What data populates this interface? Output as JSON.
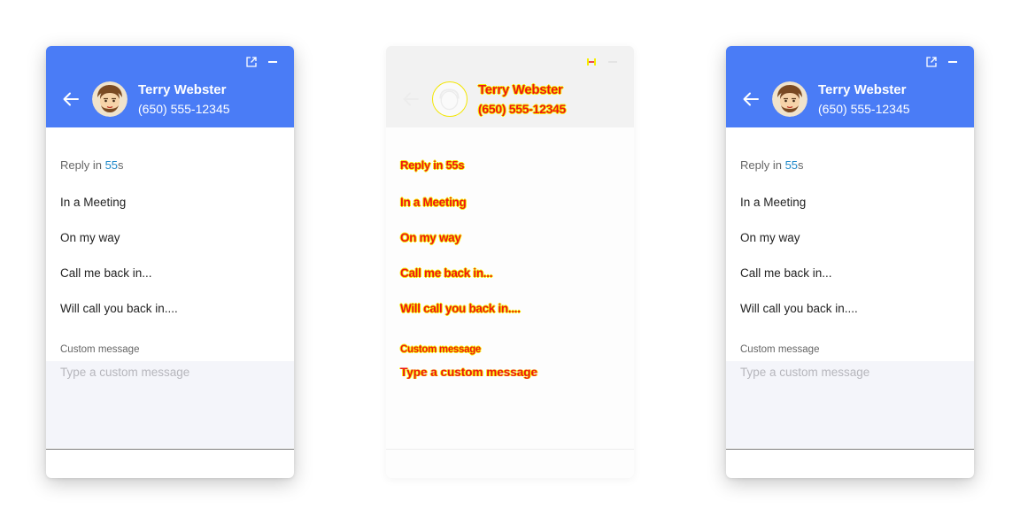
{
  "contact": {
    "name": "Terry Webster",
    "phone": "(650) 555-12345"
  },
  "reply_timer": {
    "prefix": "Reply in ",
    "count": "55",
    "unit": "s"
  },
  "quick_replies": [
    {
      "label": "In a Meeting"
    },
    {
      "label": "On my way"
    },
    {
      "label": "Call me back in..."
    },
    {
      "label": "Will call you back in...."
    }
  ],
  "custom_message": {
    "label": "Custom message",
    "placeholder": "Type a custom message",
    "value": ""
  },
  "icons": {
    "popout": "open-in-new-icon",
    "minimize": "minimize-icon",
    "back": "arrow-back-icon",
    "avatar": "contact-avatar"
  },
  "colors": {
    "header": "#4a7cf6",
    "accent": "#1e88c9",
    "input_background": "#f4f5fa"
  }
}
